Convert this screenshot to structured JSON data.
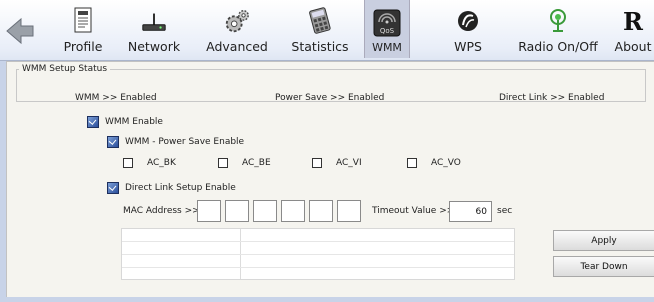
{
  "toolbar": {
    "items": [
      {
        "label": "Profile",
        "icon": "profile-document-icon"
      },
      {
        "label": "Network",
        "icon": "router-icon"
      },
      {
        "label": "Advanced",
        "icon": "gears-icon"
      },
      {
        "label": "Statistics",
        "icon": "calculator-icon"
      },
      {
        "label": "WMM",
        "icon": "qos-icon",
        "active": true
      },
      {
        "label": "WPS",
        "icon": "wps-icon"
      },
      {
        "label": "Radio On/Off",
        "icon": "radio-antenna-icon"
      },
      {
        "label": "About",
        "icon": "ralink-logo-icon"
      }
    ],
    "qos_icon_text": "QoS",
    "about_logo_text": "R"
  },
  "status": {
    "legend": "WMM Setup Status",
    "wmm": "WMM >> Enabled",
    "power_save": "Power Save >> Enabled",
    "direct_link": "Direct Link >> Enabled"
  },
  "options": {
    "wmm_enable": {
      "label": "WMM Enable",
      "checked": true
    },
    "power_save_enable": {
      "label": "WMM - Power Save Enable",
      "checked": true
    },
    "ac_bk": {
      "label": "AC_BK",
      "checked": false
    },
    "ac_be": {
      "label": "AC_BE",
      "checked": false
    },
    "ac_vi": {
      "label": "AC_VI",
      "checked": false
    },
    "ac_vo": {
      "label": "AC_VO",
      "checked": false
    },
    "direct_link_enable": {
      "label": "Direct Link Setup Enable",
      "checked": true
    }
  },
  "direct_link": {
    "mac_label": "MAC Address >>",
    "mac_fields": [
      "",
      "",
      "",
      "",
      "",
      ""
    ],
    "timeout_label": "Timeout Value >>",
    "timeout_value": "60",
    "timeout_unit": "sec"
  },
  "buttons": {
    "apply": "Apply",
    "tear_down": "Tear Down"
  },
  "colors": {
    "toolbar_bg": "#e9eef8",
    "active_tab": "#c9cfe0",
    "content_bg": "#f5f4ef",
    "window_bg": "#c8d3e8"
  }
}
